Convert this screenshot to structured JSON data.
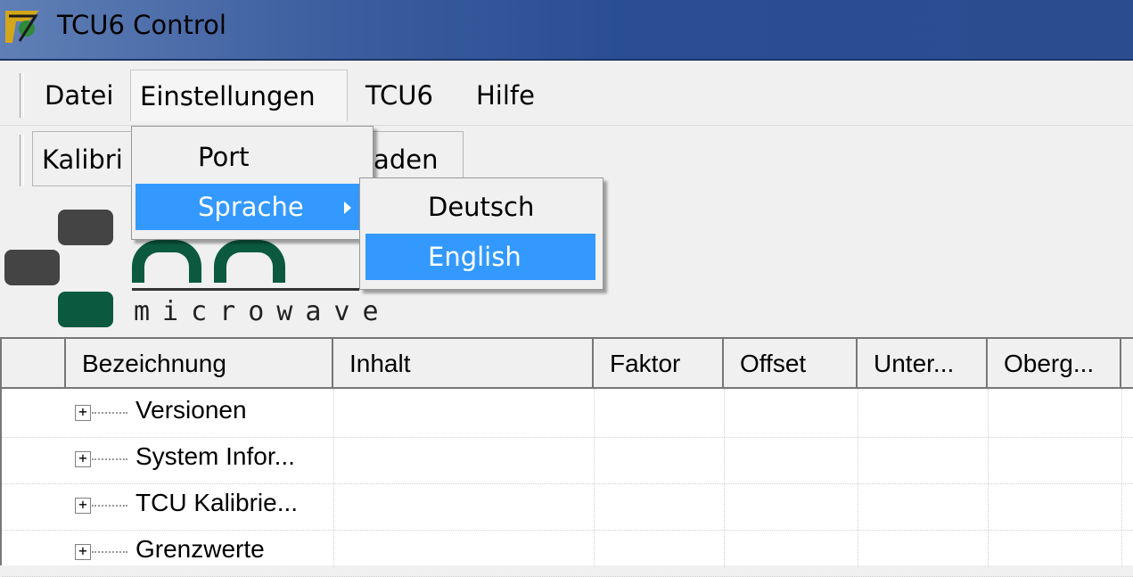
{
  "window": {
    "title": "TCU6 Control"
  },
  "menubar": {
    "items": [
      {
        "label": "Datei"
      },
      {
        "label": "Einstellungen"
      },
      {
        "label": "TCU6"
      },
      {
        "label": "Hilfe"
      }
    ]
  },
  "toolbar": {
    "buttons": [
      {
        "label": "Kalibri"
      },
      {
        "label": "laden"
      }
    ]
  },
  "logo": {
    "text": "microwave"
  },
  "settings_menu": {
    "items": [
      {
        "label": "Port"
      },
      {
        "label": "Sprache"
      }
    ]
  },
  "language_submenu": {
    "items": [
      {
        "label": "Deutsch"
      },
      {
        "label": "English"
      }
    ],
    "selected": "English"
  },
  "grid": {
    "columns": [
      "Bezeichnung",
      "Inhalt",
      "Faktor",
      "Offset",
      "Unter...",
      "Oberg..."
    ],
    "rows": [
      {
        "label": "Versionen"
      },
      {
        "label": "System Infor..."
      },
      {
        "label": "TCU Kalibrie..."
      },
      {
        "label": "Grenzwerte"
      }
    ]
  },
  "colors": {
    "highlight": "#3399ff",
    "logo_green": "#0b5a3f",
    "logo_gray": "#444444"
  }
}
